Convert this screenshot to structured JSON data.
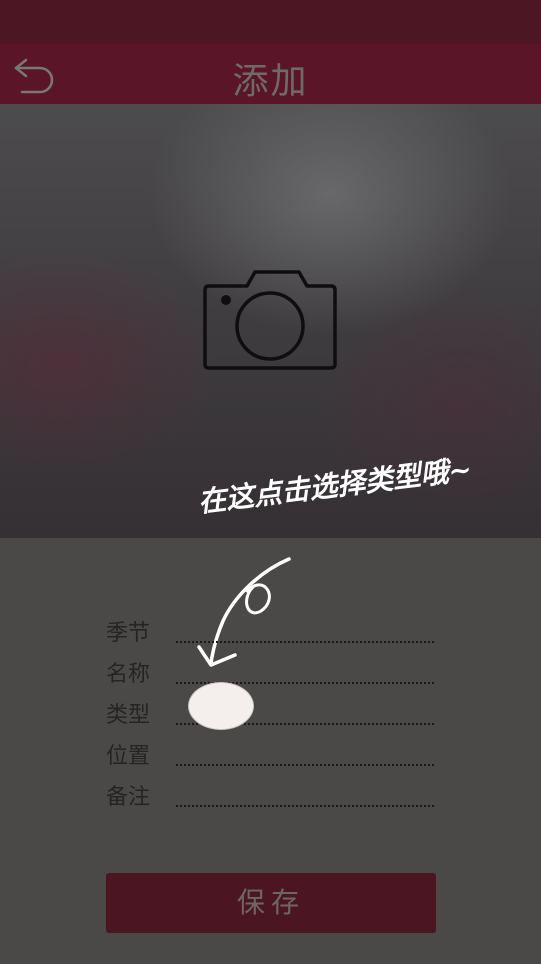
{
  "header": {
    "title": "添加",
    "back_icon": "back-arrow-icon"
  },
  "photo": {
    "camera_icon": "camera-icon",
    "hint": "在这点击选择类型哦~"
  },
  "form": {
    "season_label": "季节",
    "name_label": "名称",
    "type_label": "类型",
    "location_label": "位置",
    "note_label": "备注"
  },
  "actions": {
    "save_label": "保存"
  },
  "colors": {
    "header_bg": "#5a1528",
    "page_bg": "#4a4948",
    "button_bg": "#4c1522"
  }
}
